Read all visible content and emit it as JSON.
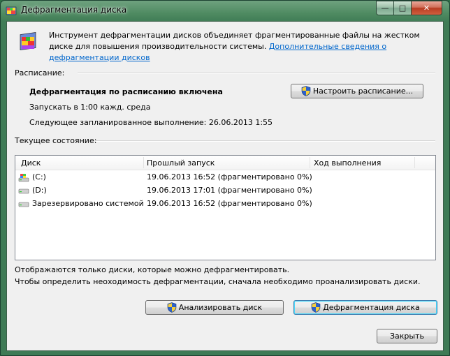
{
  "window": {
    "title": "Дефрагментация диска",
    "controls": {
      "minimize": "—",
      "maximize": "□",
      "close": "✕"
    }
  },
  "intro": {
    "text": "Инструмент дефрагментации дисков объединяет фрагментированные файлы на жестком диске для повышения производительности системы.",
    "link": "Дополнительные сведения о дефрагментации дисков"
  },
  "schedule": {
    "label": "Расписание:",
    "status": "Дефрагментация по расписанию включена",
    "run_at": "Запускать в 1:00 кажд. среда",
    "next_run": "Следующее запланированное выполнение: 26.06.2013 1:55",
    "configure_button": "Настроить расписание..."
  },
  "current": {
    "label": "Текущее состояние:",
    "columns": [
      "Диск",
      "Прошлый запуск",
      "Ход выполнения"
    ],
    "rows": [
      {
        "disk": "(C:)",
        "last_run": "19.06.2013 16:52 (фрагментировано 0%)",
        "progress": "",
        "icon": "system-drive-icon"
      },
      {
        "disk": "(D:)",
        "last_run": "19.06.2013 17:01 (фрагментировано 0%)",
        "progress": "",
        "icon": "drive-icon"
      },
      {
        "disk": "Зарезервировано системой",
        "last_run": "19.06.2013 16:52 (фрагментировано 0%)",
        "progress": "",
        "icon": "drive-icon"
      }
    ]
  },
  "notes": {
    "line1": "Отображаются только диски, которые можно дефрагментировать.",
    "line2": "Чтобы определить неоходимость  дефрагментации, сначала необходимо проанализировать диски."
  },
  "buttons": {
    "analyze": "Анализировать диск",
    "defrag": "Дефрагментация диска",
    "close": "Закрыть"
  }
}
